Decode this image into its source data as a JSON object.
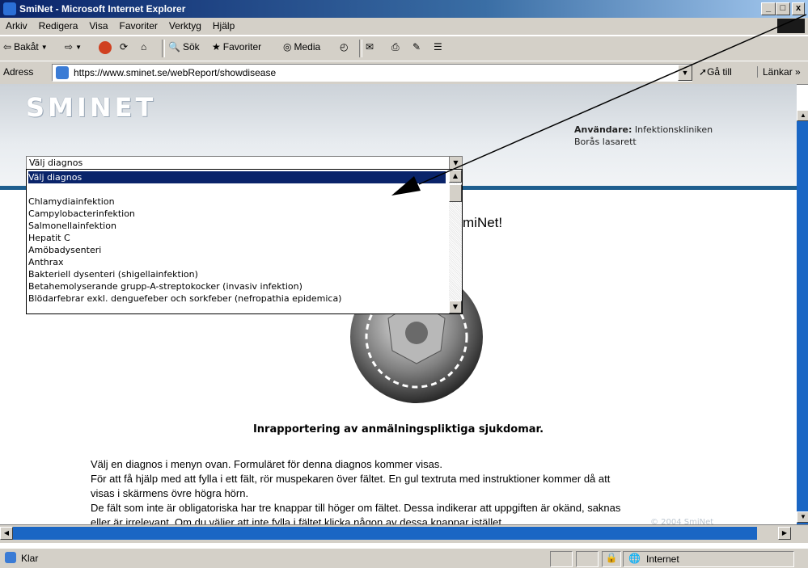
{
  "window": {
    "title": "SmiNet - Microsoft Internet Explorer",
    "minimize": "_",
    "maximize": "□",
    "close": "x"
  },
  "menu": {
    "items": [
      "Arkiv",
      "Redigera",
      "Visa",
      "Favoriter",
      "Verktyg",
      "Hjälp"
    ]
  },
  "toolbar": {
    "back": "Bakåt",
    "search": "Sök",
    "favorites": "Favoriter",
    "media": "Media"
  },
  "address": {
    "label": "Adress",
    "url": "https://www.sminet.se/webReport/showdisease",
    "go": "Gå till",
    "links": "Länkar"
  },
  "header": {
    "logo": "SMINET",
    "user_label": "Användare:",
    "user_name": "Infektionskliniken",
    "user_org": "Borås lasarett"
  },
  "select": {
    "value": "Välj diagnos",
    "options": [
      "Välj diagnos",
      "",
      "Chlamydiainfektion",
      "Campylobacterinfektion",
      "Salmonellainfektion",
      "Hepatit C",
      "Amöbadysenteri",
      "Anthrax",
      "Bakteriell dysenteri (shigellainfektion)",
      "Betahemolyserande grupp-A-streptokocker (invasiv infektion)",
      "Blödarfebrar exkl. denguefeber och sorkfeber (nefropathia epidemica)"
    ]
  },
  "main": {
    "welcome_tail": "miNet!",
    "subtitle": "Inrapportering av anmälningspliktiga sjukdomar.",
    "paragraphs": [
      "Välj en diagnos i menyn ovan. Formuläret för denna diagnos kommer visas.",
      "För att få hjälp med att fylla i ett fält, rör muspekaren över fältet. En gul textruta med instruktioner kommer då att",
      "visas i skärmens övre högra hörn.",
      "De fält som inte är obligatoriska har tre knappar till höger om fältet. Dessa indikerar att uppgiften är okänd, saknas",
      "eller är irrelevant. Om du väljer att inte fylla i fältet klicka någon av dessa knappar istället."
    ],
    "copyright": "© 2004 SmiNet"
  },
  "status": {
    "text": "Klar",
    "zone": "Internet"
  }
}
